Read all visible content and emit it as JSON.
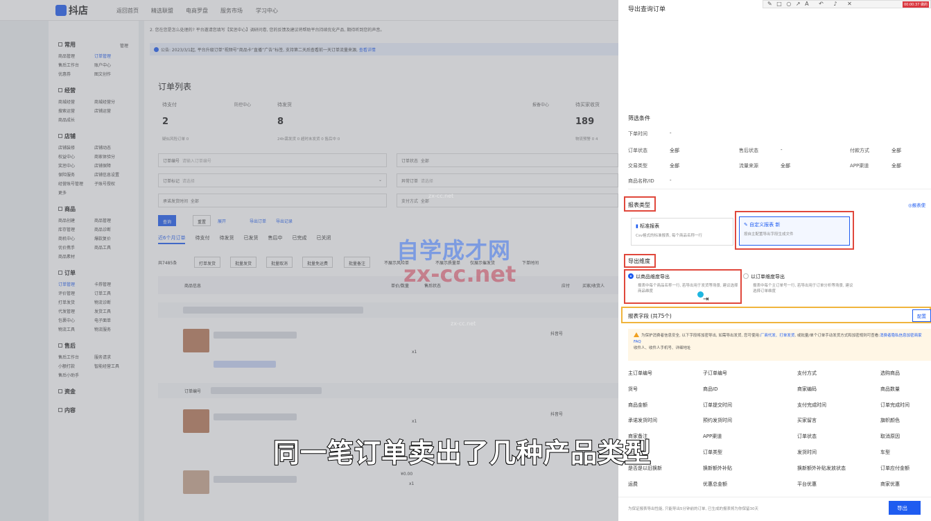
{
  "brand": {
    "name": "抖店"
  },
  "topnav": [
    "返回首页",
    "精选联盟",
    "电商罗盘",
    "服务市场",
    "学习中心"
  ],
  "sidebar": {
    "manage_link": "管理",
    "groups": [
      {
        "title": "常用",
        "rows": [
          [
            "商品管理",
            "订单管理"
          ],
          [
            "售后工作台",
            "账户中心"
          ],
          [
            "优惠券",
            "图文创作"
          ]
        ]
      },
      {
        "title": "经营",
        "rows": [
          [
            "商城经营",
            "商城经营分"
          ],
          [
            "搜索运营",
            "店铺运营"
          ],
          [
            "商品成长",
            ""
          ]
        ]
      },
      {
        "title": "店铺",
        "rows": [
          [
            "店铺装修",
            "店铺动态"
          ],
          [
            "权益中心",
            "商家体验分"
          ],
          [
            "奖惩中心",
            "店铺保障"
          ],
          [
            "保险服务",
            "店铺信息设置"
          ],
          [
            "经营账号管理",
            "子账号授权"
          ],
          [
            "更多",
            ""
          ]
        ]
      },
      {
        "title": "商品",
        "rows": [
          [
            "商品创建",
            "商品管理"
          ],
          [
            "库存管理",
            "商品诊断"
          ],
          [
            "商机中心",
            "爆款复价"
          ],
          [
            "优价携手",
            "商品工具"
          ],
          [
            "商品素材",
            ""
          ]
        ]
      },
      {
        "title": "订单",
        "rows": [
          [
            "订单管理",
            "卡券管理"
          ],
          [
            "评价管理",
            "订单工具"
          ],
          [
            "打单发货",
            "物流诊断"
          ],
          [
            "代发管理",
            "发货工具"
          ],
          [
            "包裹中心",
            "电子面单"
          ],
          [
            "物流工具",
            "物流服务"
          ]
        ]
      },
      {
        "title": "售后",
        "rows": [
          [
            "售后工作台",
            "服务请求"
          ],
          [
            "小额打款",
            "智能经营工具"
          ],
          [
            "售后小助手",
            ""
          ]
        ]
      },
      {
        "title": "资金",
        "rows": []
      },
      {
        "title": "内容",
        "rows": []
      }
    ]
  },
  "main": {
    "notice1": "2. 您在您是怎么处理的?  平台邀请您填写【奖惩中心】调研问卷, 您的反馈及建议将帮助平台持续优化产品, 期待听到您的声音。",
    "notice2": "公告: 2023/3/1起, 平台升级订单“视频号”商品卡”直播”广告”标签, 支持第二天后查看前一天订单流量来源,",
    "notice2_link": "查看详情",
    "list_title": "订单列表",
    "stats": [
      {
        "label": "待支付",
        "side": "防控中心",
        "value": "2",
        "sub": "疑似风险订单  0"
      },
      {
        "label": "待发货",
        "side": "报备中心",
        "value": "8",
        "sub": "24h需发货 0   超时未发货 0   售后中 0"
      },
      {
        "label": "待买家收货",
        "side": "",
        "value": "189",
        "sub": "物流预警 0  4"
      }
    ],
    "filters": [
      {
        "label": "订单编号",
        "placeholder": "请输入订单编号"
      },
      {
        "label": "订单状态",
        "value": "全部"
      },
      {
        "label": "订单标记",
        "placeholder": "请选择"
      },
      {
        "label": "异常订单",
        "placeholder": "请选择"
      },
      {
        "label": "承诺发货时间",
        "value": "全部"
      },
      {
        "label": "支付方式",
        "value": "全部"
      }
    ],
    "actions": {
      "query": "查询",
      "reset": "重置",
      "expand": "展开",
      "export": "导出订单",
      "export_log": "导出记录"
    },
    "tabs": [
      "近6个月订单",
      "待支付",
      "待发货",
      "已发货",
      "售后中",
      "已完成",
      "已关闭"
    ],
    "bulk": {
      "count": "共7485条",
      "buttons": [
        "打单发货",
        "批量发货",
        "批量取消",
        "批量免运费",
        "批量备注"
      ],
      "checks": [
        "不展示风险单",
        "不展示质量单",
        "仅展示催发货",
        "下单时间"
      ]
    },
    "table_head": [
      "商品信息",
      "单价/数量",
      "售后状态",
      "应付",
      "买家/收货人"
    ],
    "rows": [
      {
        "order_label": "订单编号",
        "price": "",
        "qty": "x1",
        "status_link": "抖音号"
      },
      {
        "order_label": "订单编号",
        "price": "",
        "qty": "x1",
        "status_link": "抖音号"
      },
      {
        "order_label": "",
        "price": "¥0.00",
        "qty": "x1",
        "status_link": ""
      }
    ]
  },
  "watermark": {
    "cn": "自学成才网",
    "en": "zx-cc.net",
    "small": "zx-cc.net"
  },
  "caption": "同一笔订单卖出了几种产品类型",
  "panel": {
    "title": "导出查询订单",
    "rec_time": "00:00:37 做的",
    "filter_title": "筛选条件",
    "filters": [
      {
        "label": "下单时间",
        "value": "-"
      },
      {
        "label": "订单状态",
        "value": "全部"
      },
      {
        "label": "售后状态",
        "value": "-"
      },
      {
        "label": "付款方式",
        "value": "全部"
      },
      {
        "label": "交易类型",
        "value": "全部"
      },
      {
        "label": "流量来源",
        "value": "全部"
      },
      {
        "label": "APP渠道",
        "value": "全部"
      },
      {
        "label": "商品名称/ID",
        "value": "-"
      }
    ],
    "report_type_title": "报表类型",
    "report_example": "◎报表使",
    "report_std": {
      "title": "标准报表",
      "desc": "Csv格式的标准报表, 每个商品名称一行"
    },
    "report_custom": {
      "title": "自定义报表 新",
      "desc": "按自主配置导出字段生成文件"
    },
    "dim_title": "导出维度",
    "dim_goods": {
      "title": "以商品维度导出",
      "desc": "报表中每个商品名称一行, 若导出用于发货等场景, 建议选择商品维度"
    },
    "dim_order": {
      "title": "以订单维度导出",
      "desc": "报表中每个主订单号一行, 若导出用于订单分析等场景, 建议选择订单维度"
    },
    "fields_title": "报表字段 (共75个)",
    "config": "配置",
    "warn_text": "为保护消费者信息安全, 以下字段将加密导出, 如需导出发货, 您可使用:",
    "warn_links": "厂商代发、打单发货",
    "warn_text2": "或批量/单个订单手动发货方式和加密规则可查看:",
    "warn_link2": "消费者隐私信息加密商家FAQ",
    "warn_text3": "收件人、收件人手机号、详细地址",
    "fields": [
      [
        "主订单编号",
        "子订单编号",
        "支付方式",
        "选购商品"
      ],
      [
        "货号",
        "商品ID",
        "商家编码",
        "商品数量"
      ],
      [
        "商品金额",
        "订单提交时间",
        "支付完成时间",
        "订单完成时间"
      ],
      [
        "承诺发货时间",
        "预约发货时间",
        "买家留言",
        "旗帜颜色"
      ],
      [
        "商家备注",
        "APP渠道",
        "订单状态",
        "取消原因"
      ],
      [
        "运费",
        "订单类型",
        "发货时间",
        "车型"
      ],
      [
        "是否是以旧换新",
        "换新额外补贴",
        "换新额外补贴发放状态",
        "订单应付金额"
      ],
      [
        "运费",
        "优惠总金额",
        "平台优惠",
        "商家优惠"
      ]
    ],
    "footer_note": "为保证报表导出性能, 只能导出5分钟前的订单, 已生成的报表将为你保留30天",
    "export": "导出"
  }
}
